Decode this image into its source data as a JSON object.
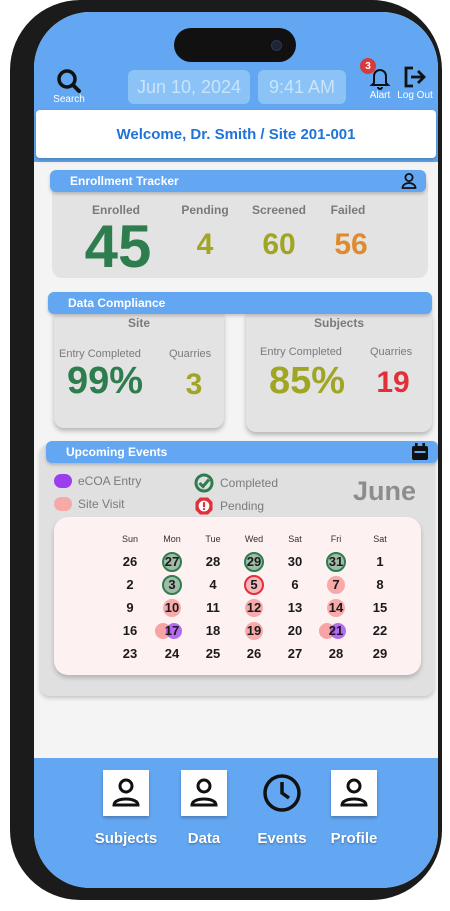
{
  "header": {
    "search_label": "Search",
    "date": "Jun 10, 2024",
    "time": "9:41 AM",
    "alert_label": "Alart",
    "alert_count": "3",
    "logout_label": "Log Out",
    "welcome": "Welcome, Dr. Smith / Site 201-001"
  },
  "enrollment": {
    "title": "Enrollment Tracker",
    "enrolled_label": "Enrolled",
    "enrolled_value": "45",
    "pending_label": "Pending",
    "pending_value": "4",
    "screened_label": "Screened",
    "screened_value": "60",
    "failed_label": "Failed",
    "failed_value": "56"
  },
  "compliance": {
    "title": "Data Compliance",
    "site": {
      "title": "Site",
      "entry_label": "Entry Completed",
      "entry_value": "99%",
      "quarries_label": "Quarries",
      "quarries_value": "3"
    },
    "subjects": {
      "title": "Subjects",
      "entry_label": "Entry Completed",
      "entry_value": "85%",
      "quarries_label": "Quarries",
      "quarries_value": "19"
    }
  },
  "events": {
    "title": "Upcoming Events",
    "legend": {
      "ecoa": "eCOA Entry",
      "site_visit": "Site Visit",
      "completed": "Completed",
      "pending": "Pending"
    },
    "month": "June",
    "weekdays": [
      "Sun",
      "Mon",
      "Tue",
      "Wed",
      "Sat",
      "Fri",
      "Sat"
    ],
    "weeks": [
      [
        "26",
        "27",
        "28",
        "29",
        "30",
        "31",
        "1"
      ],
      [
        "2",
        "3",
        "4",
        "5",
        "6",
        "7",
        "8"
      ],
      [
        "9",
        "10",
        "11",
        "12",
        "13",
        "14",
        "15"
      ],
      [
        "16",
        "17",
        "18",
        "19",
        "20",
        "21",
        "22"
      ],
      [
        "23",
        "24",
        "25",
        "26",
        "27",
        "28",
        "29"
      ]
    ]
  },
  "nav": {
    "subjects": "Subjects",
    "data": "Data",
    "events": "Events",
    "profile": "Profile"
  },
  "colors": {
    "accent_blue": "#63a7f3",
    "enrolled_green": "#2e7d4f",
    "olive": "#a0a624",
    "orange": "#e08a2e",
    "red": "#e0313a",
    "ecoa_purple": "#9b3ef0",
    "site_visit_pink": "#f5aaa8"
  }
}
